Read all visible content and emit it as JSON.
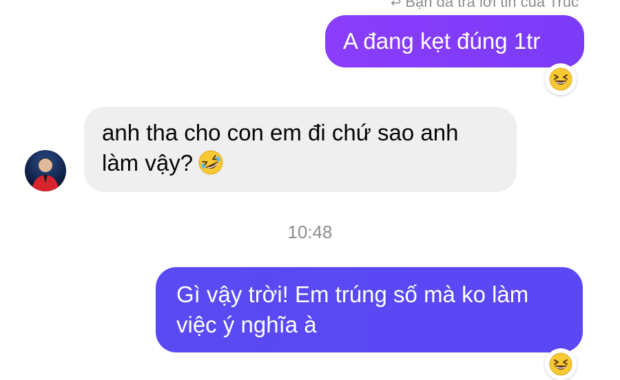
{
  "reply_note": "Bạn đã trả lời tin của Trúc",
  "messages": [
    {
      "text": "A đang kẹt đúng 1tr",
      "direction": "outgoing",
      "reaction": "grinning-squinting-face"
    },
    {
      "text_line1": "anh tha cho con em đi chứ sao anh",
      "text_line2": "làm vậy?",
      "direction": "incoming",
      "inline_emoji": "rolling-on-floor-laughing"
    },
    {
      "text_line1": "Gì vậy trời! Em trúng số mà ko làm",
      "text_line2": "việc ý nghĩa à",
      "direction": "outgoing",
      "reaction": "grinning-squinting-face"
    }
  ],
  "timestamp": "10:48",
  "colors": {
    "outgoing_top": "#8a3dfb",
    "outgoing_bottom": "#5a4af3",
    "incoming_bg": "#efefef",
    "meta_text": "#8a8d91"
  }
}
